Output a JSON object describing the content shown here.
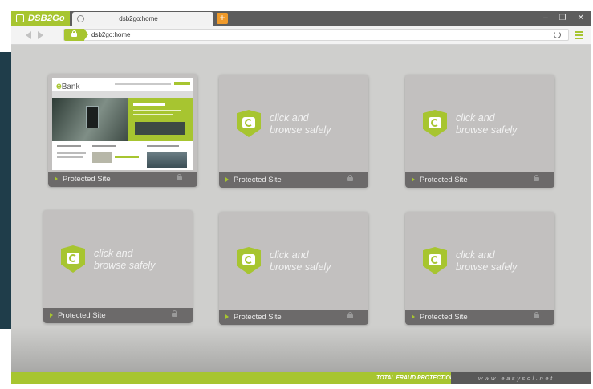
{
  "app": {
    "brand": "DSB2Go"
  },
  "tab": {
    "title": "dsb2go:home",
    "new_tab_label": "+"
  },
  "window_controls": {
    "minimize": "–",
    "restore": "❐",
    "close": "✕"
  },
  "address": {
    "url": "dsb2go:home"
  },
  "tiles": [
    {
      "type": "site",
      "label": "Protected Site",
      "site_logo": "Bank"
    },
    {
      "type": "empty",
      "label": "Protected Site",
      "line1": "click and",
      "line2": "browse safely"
    },
    {
      "type": "empty",
      "label": "Protected Site",
      "line1": "click and",
      "line2": "browse safely"
    },
    {
      "type": "empty",
      "label": "Protected Site",
      "line1": "click and",
      "line2": "browse safely"
    },
    {
      "type": "empty",
      "label": "Protected Site",
      "line1": "click and",
      "line2": "browse safely"
    },
    {
      "type": "empty",
      "label": "Protected Site",
      "line1": "click and",
      "line2": "browse safely"
    }
  ],
  "footer": {
    "brand": "TOTAL FRAUD PROTECTION®",
    "url": "www.easysol.net"
  },
  "colors": {
    "accent": "#a7c530",
    "tab_accent": "#f09a2a",
    "titlebar": "#5d5d5d",
    "tile_bar": "#6c6a6a"
  },
  "icons": {
    "brand": "app-icon",
    "tab": "globe-icon",
    "secure": "lock-icon",
    "reload": "refresh-icon",
    "menu": "menu-icon",
    "tile": "shield-icon"
  }
}
